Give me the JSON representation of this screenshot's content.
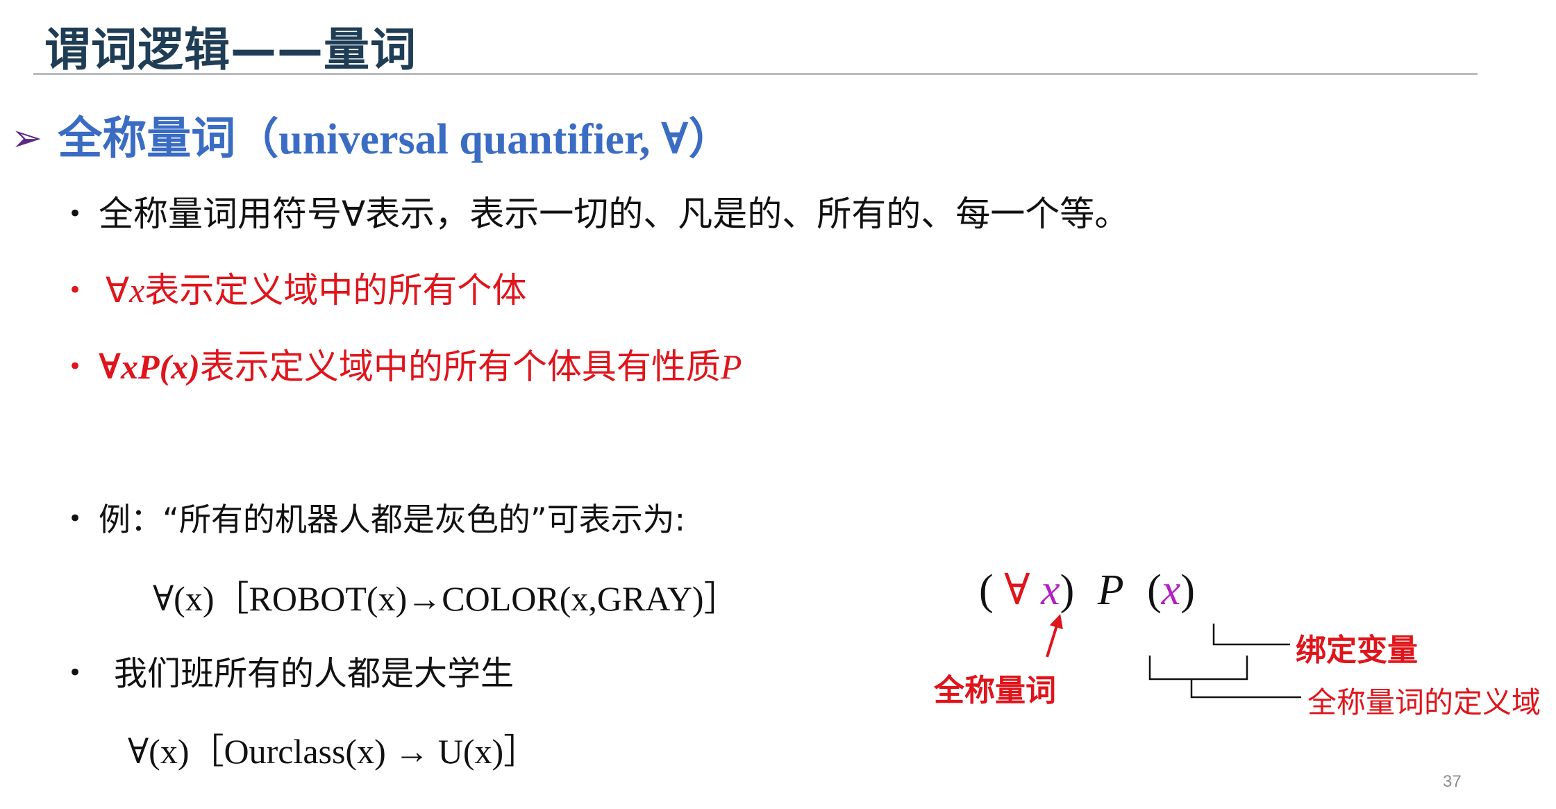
{
  "slide": {
    "title": "谓词逻辑——量词",
    "heading_cn": "全称量词",
    "heading_en": "（universal quantifier, ∀）",
    "bullets": [
      "全称量词用符号∀表示，表示一切的、凡是的、所有的、每一个等。",
      {
        "sym": "∀",
        "var": "x",
        "text": "表示定义域中的所有个体"
      },
      {
        "prefix": "∀xP(x)",
        "text": "表示定义域中的所有个体具有性质",
        "suffix": "P"
      }
    ],
    "example_label": "例：“所有的机器人都是灰色的”可表示为:",
    "formula1": "∀(x)［ROBOT(x)→COLOR(x,GRAY)］",
    "example2": "我们班所有的人都是大学生",
    "formula2": "∀(x)［Ourclass(x) → U(x)］",
    "diagram": {
      "forall": "∀",
      "x1": "x",
      "P": "P",
      "x2": "x",
      "label_quantifier": "全称量词",
      "label_bound_var": "绑定变量",
      "label_domain": "全称量词的定义域"
    },
    "page_number": "37"
  },
  "colors": {
    "title": "#1f3d55",
    "heading": "#3a6cc4",
    "accent_red": "#e0141b",
    "variable_purple": "#b31ec3"
  }
}
